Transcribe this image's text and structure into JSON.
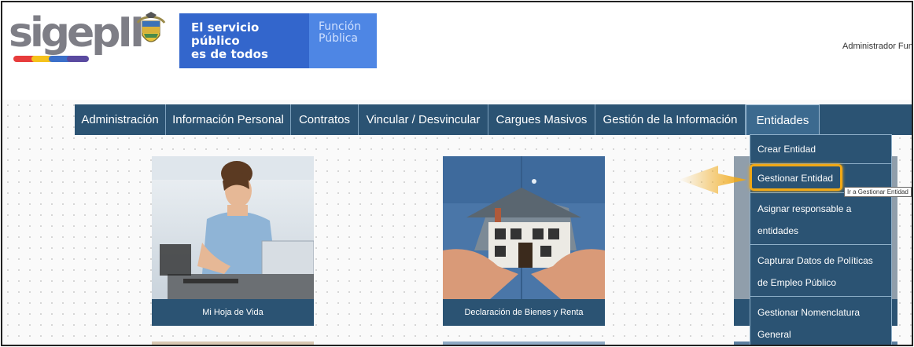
{
  "header": {
    "logo_text": "sigep",
    "logo_suffix": "II",
    "gov_slogan_line1": "El servicio público",
    "gov_slogan_line2": "es de todos",
    "gov_entity_line1": "Función",
    "gov_entity_line2": "Pública",
    "user_label": "Administrador Func"
  },
  "nav": {
    "items": [
      {
        "label": "Administración"
      },
      {
        "label": "Información Personal"
      },
      {
        "label": "Contratos"
      },
      {
        "label": "Vincular / Desvincular"
      },
      {
        "label": "Cargues Masivos"
      },
      {
        "label": "Gestión de la Información"
      },
      {
        "label": "Entidades"
      }
    ]
  },
  "dropdown": {
    "items": [
      {
        "label": "Crear Entidad"
      },
      {
        "label": "Gestionar Entidad"
      },
      {
        "label": "Asignar responsable a entidades"
      },
      {
        "label": "Capturar Datos de Políticas de Empleo Público"
      },
      {
        "label": "Gestionar Nomenclatura General"
      }
    ]
  },
  "tooltip": "Ir a Gestionar Entidad",
  "cards": [
    {
      "label": "Mi Hoja de Vida"
    },
    {
      "label": "Declaración de Bienes y Renta"
    }
  ],
  "colors": {
    "nav_bg": "#2b5373",
    "gov_blue": "#3366cc",
    "gov_light_blue": "#4e86e4",
    "highlight": "#f0a816",
    "logo_gray": "#7e7e86"
  }
}
